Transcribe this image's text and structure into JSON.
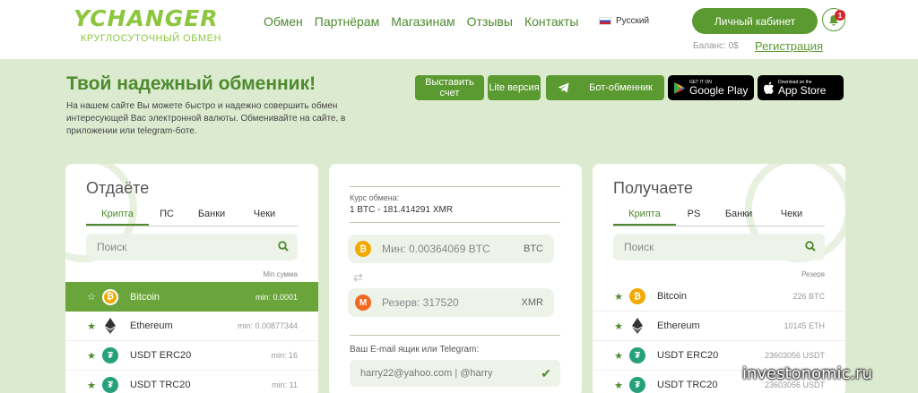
{
  "logo": {
    "name": "YCHANGER",
    "tagline": "КРУГЛОСУТОЧНЫЙ ОБМЕН"
  },
  "nav": [
    "Обмен",
    "Партнёрам",
    "Магазинам",
    "Отзывы",
    "Контакты"
  ],
  "language": "Русский",
  "header": {
    "cabinet_label": "Личный кабинет",
    "notification_count": "1",
    "balance": "Баланс: 0$",
    "register_label": "Регистрация"
  },
  "hero": {
    "title": "Твой надежный обменник!",
    "text": "На нашем сайте Вы можете быстро и надежно совершить обмен интересующей Вас электронной валюты. Обменивайте на сайте, в приложении или telegram-боте.",
    "invoice_btn": "Выставить счет",
    "lite_btn": "Lite версия",
    "bot_btn": "Бот-обменник",
    "google_small": "GET IT ON",
    "google_big": "Google Play",
    "apple_small": "Download on the",
    "apple_big": "App Store"
  },
  "give": {
    "title": "Отдаёте",
    "tabs": [
      "Крипта",
      "ПС",
      "Банки",
      "Чеки"
    ],
    "search_placeholder": "Поиск",
    "column_head": "Min сумма",
    "rows": [
      {
        "name": "Bitcoin",
        "value": "min: 0.0001"
      },
      {
        "name": "Ethereum",
        "value": "min: 0.00877344"
      },
      {
        "name": "USDT ERC20",
        "value": "min: 16"
      },
      {
        "name": "USDT TRC20",
        "value": "min: 11"
      }
    ]
  },
  "middle": {
    "rate_label": "Курс обмена:",
    "rate_value": "1 BTC - 181.414291 XMR",
    "give_amount": "Мин: 0.00364069 BTC",
    "give_currency": "BTC",
    "get_amount": "Резерв: 317520",
    "get_currency": "XMR",
    "email_label": "Ваш E-mail ящик или Telegram:",
    "email_value": "harry22@yahoo.com | @harry"
  },
  "get": {
    "title": "Получаете",
    "tabs": [
      "Крипта",
      "PS",
      "Банки",
      "Чеки"
    ],
    "search_placeholder": "Поиск",
    "column_head": "Резерв",
    "rows": [
      {
        "name": "Bitcoin",
        "value": "226 BTC"
      },
      {
        "name": "Ethereum",
        "value": "10145 ETH"
      },
      {
        "name": "USDT ERC20",
        "value": "23603056 USDT"
      },
      {
        "name": "USDT TRC20",
        "value": "23603056 USDT"
      }
    ]
  },
  "watermark": "investonomic.ru",
  "colors": {
    "accent": "#5b9a31",
    "background": "#dcebd0",
    "bitcoin": "#f2a900",
    "tether": "#26a17b",
    "monero": "#f26822"
  }
}
